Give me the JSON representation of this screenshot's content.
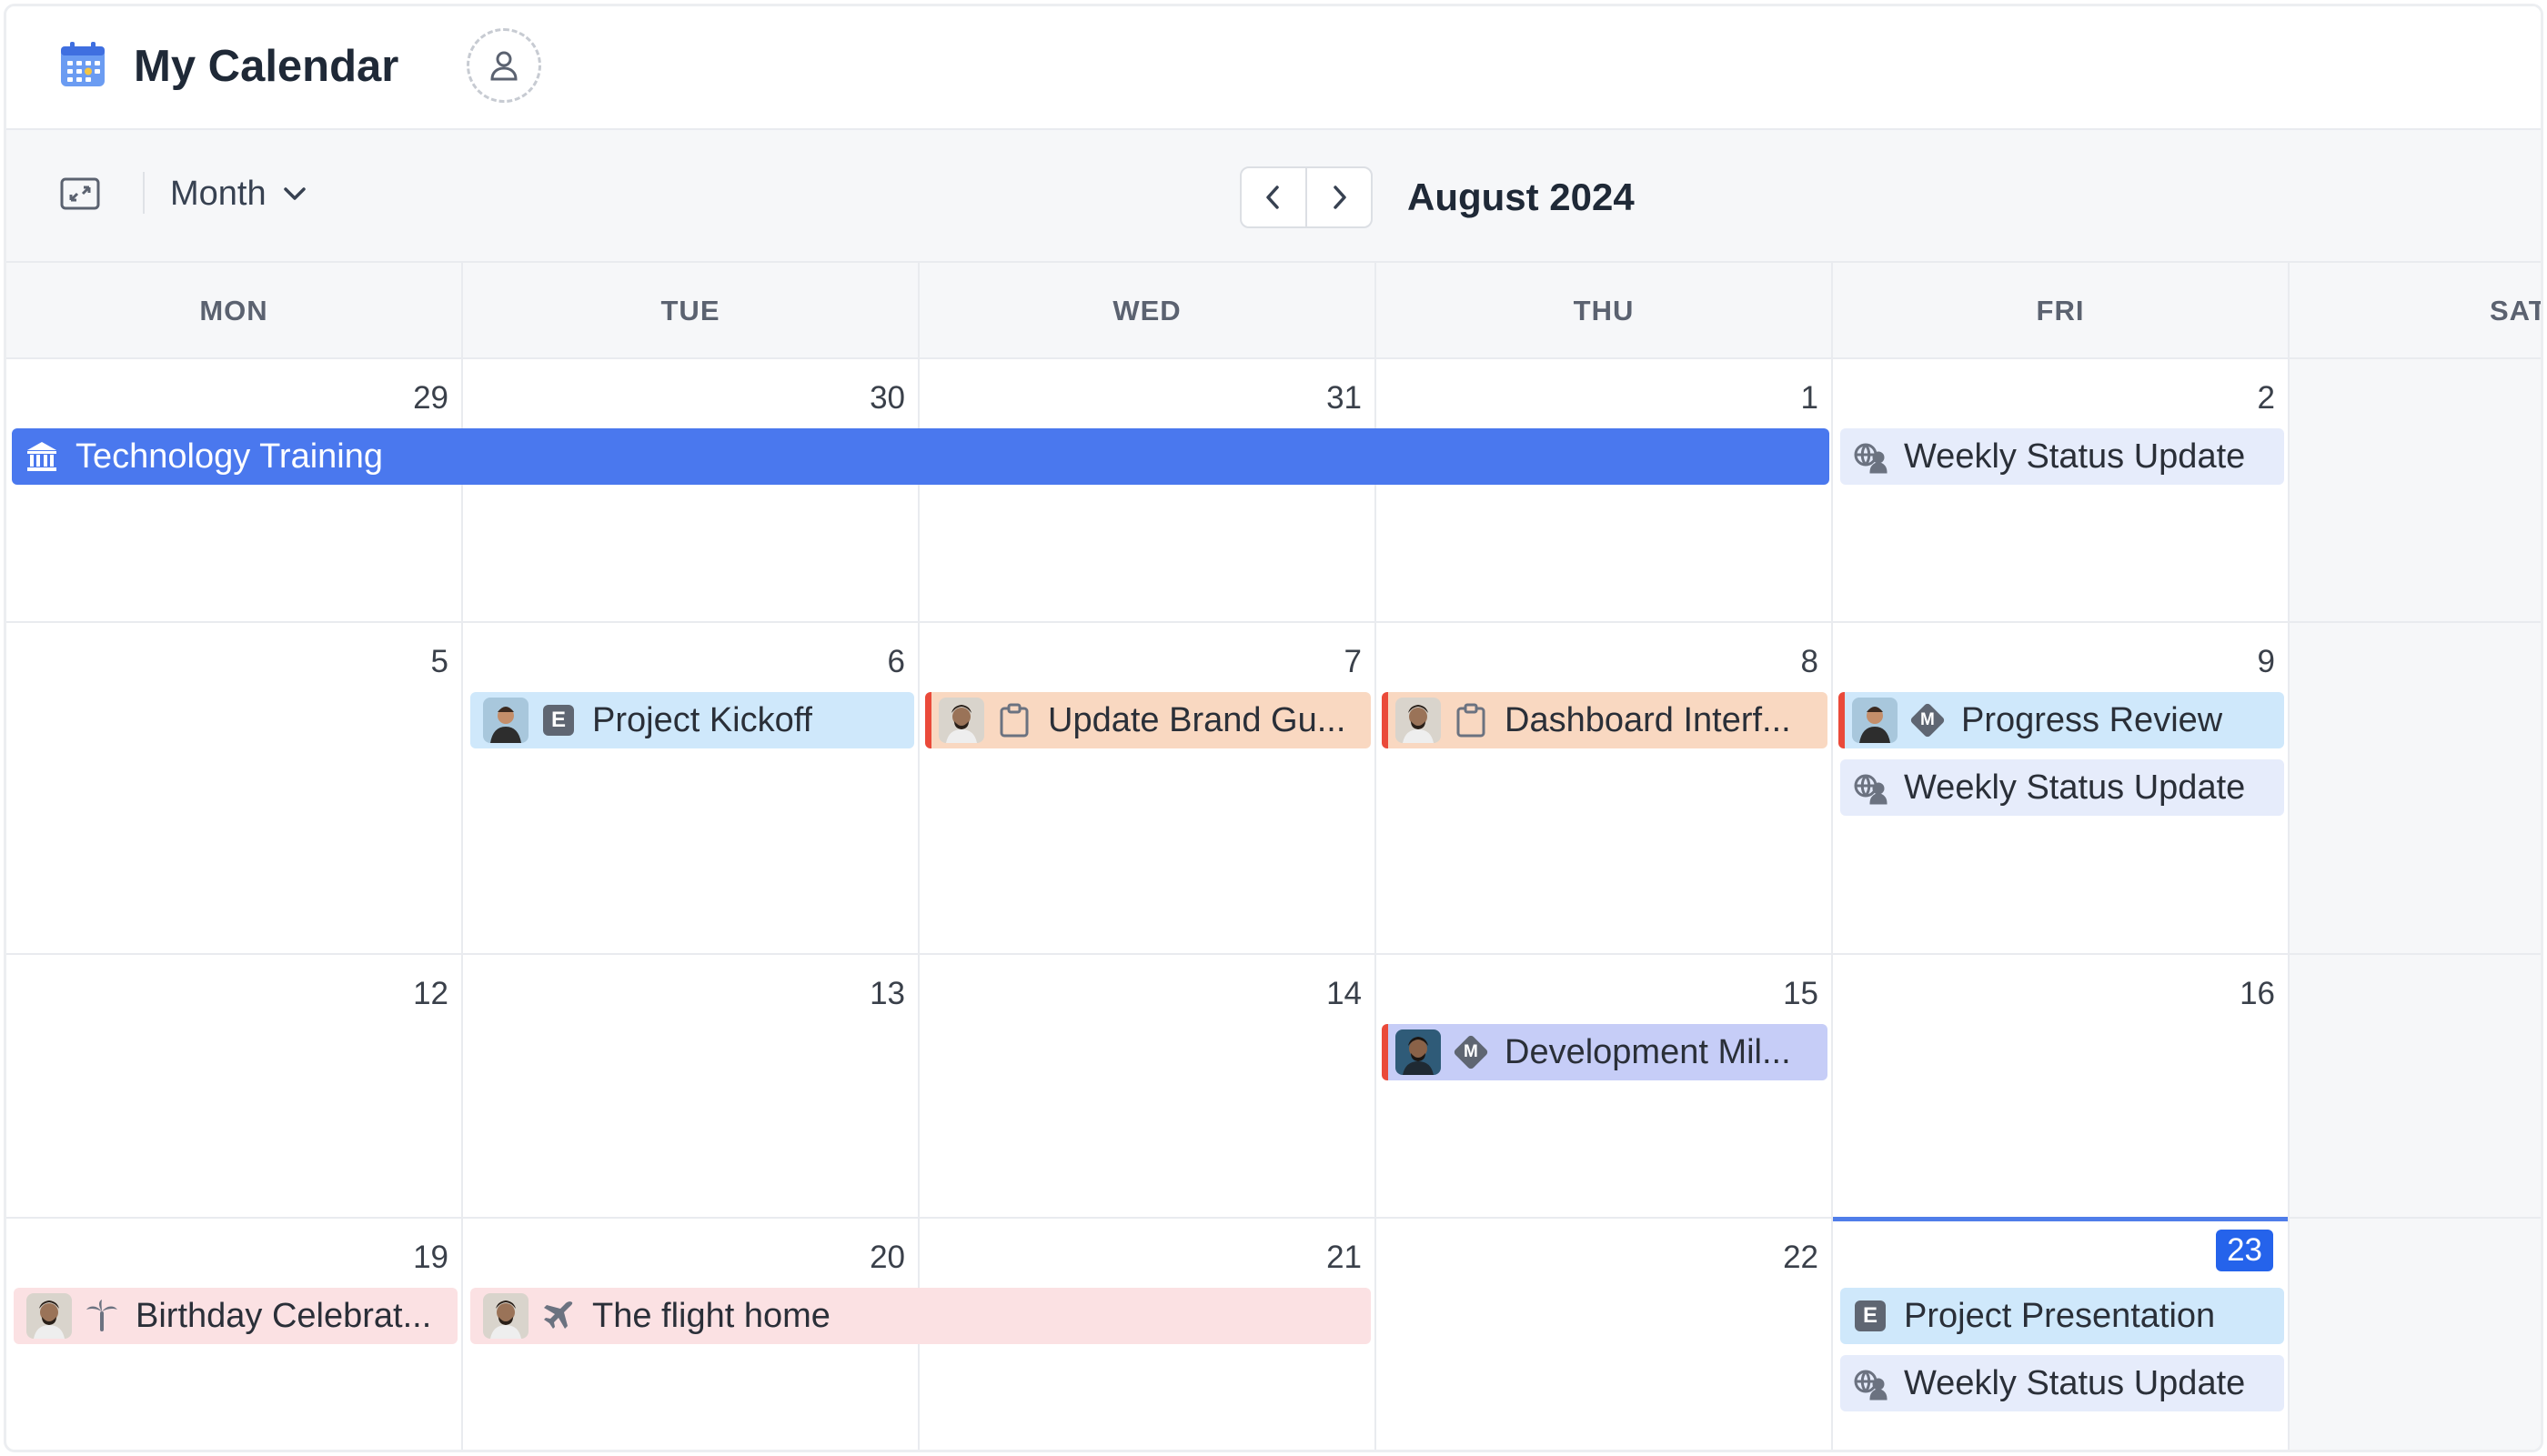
{
  "app": {
    "title": "My Calendar"
  },
  "toolbar": {
    "view": "Month",
    "period": "August 2024"
  },
  "weekdays": [
    "MON",
    "TUE",
    "WED",
    "THU",
    "FRI",
    "SAT"
  ],
  "weeks": [
    {
      "days": [
        "29",
        "30",
        "31",
        "1",
        "2",
        ""
      ]
    },
    {
      "days": [
        "5",
        "6",
        "7",
        "8",
        "9",
        ""
      ]
    },
    {
      "days": [
        "12",
        "13",
        "14",
        "15",
        "16",
        ""
      ]
    },
    {
      "days": [
        "19",
        "20",
        "21",
        "22",
        "23",
        ""
      ]
    }
  ],
  "today": "23",
  "events": {
    "technology_training": "Technology Training",
    "weekly_status_1": "Weekly Status Update",
    "project_kickoff": "Project Kickoff",
    "update_brand": "Update Brand Gu...",
    "dashboard_interface": "Dashboard Interf...",
    "progress_review": "Progress Review",
    "weekly_status_2": "Weekly Status Update",
    "development_milestone": "Development Mil...",
    "birthday": "Birthday Celebrat...",
    "flight_home": "The flight home",
    "project_presentation": "Project Presentation",
    "weekly_status_3": "Weekly Status Update"
  },
  "event_badges": {
    "event": "E",
    "milestone": "M"
  },
  "colors": {
    "accent": "#2563eb",
    "training_bar": "#4a78ee",
    "light_blue_event": "#cfe8fb",
    "grey_blue_event": "#e6ecfb",
    "peach_event": "#f9d8c1",
    "periwinkle_event": "#c6cdf7",
    "pink_event": "#fbe1e3",
    "priority_marker": "#ea4a3a"
  }
}
